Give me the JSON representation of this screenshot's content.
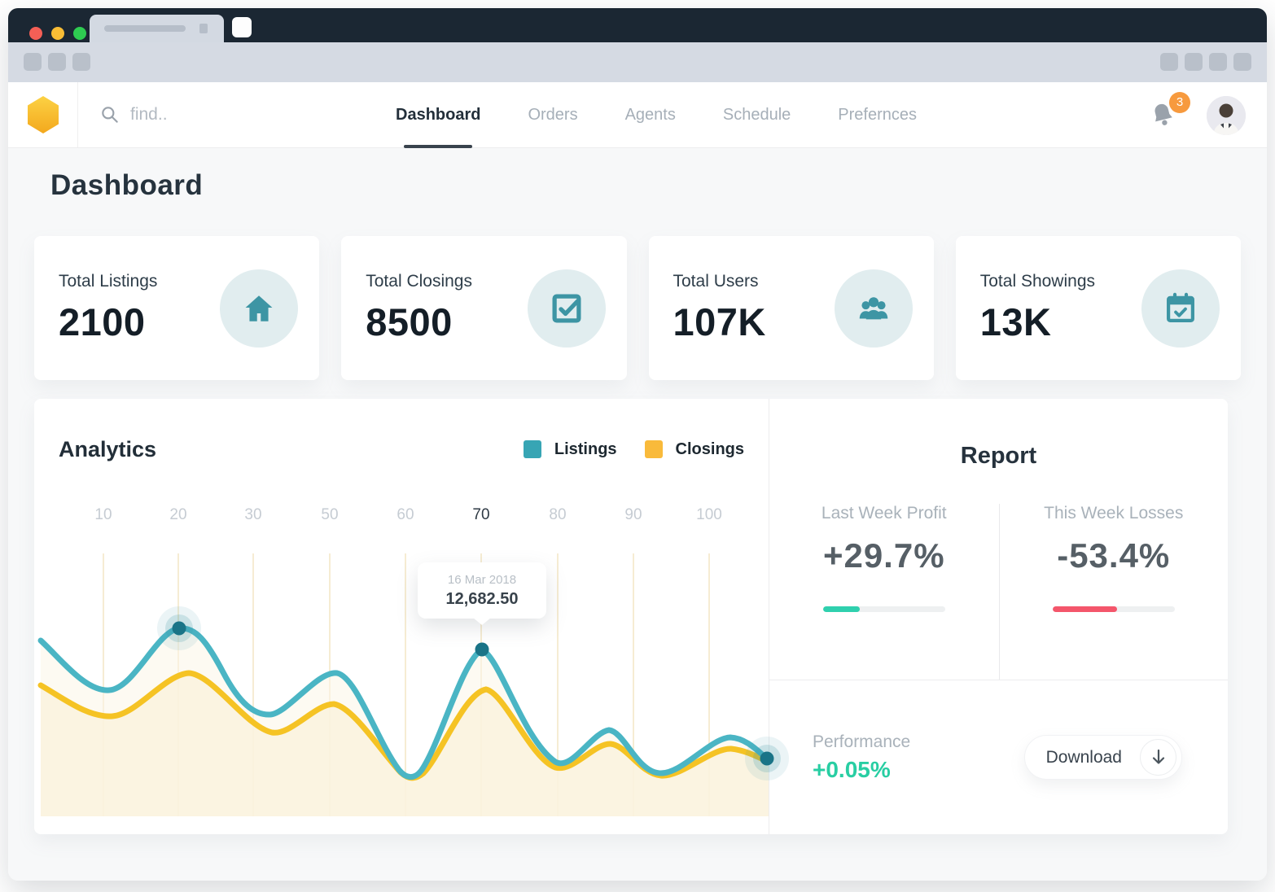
{
  "header": {
    "search": {
      "placeholder": "find.."
    },
    "nav": {
      "items": [
        {
          "label": "Dashboard",
          "active": true
        },
        {
          "label": "Orders",
          "active": false
        },
        {
          "label": "Agents",
          "active": false
        },
        {
          "label": "Schedule",
          "active": false
        },
        {
          "label": "Prefernces",
          "active": false
        }
      ]
    },
    "notifications": {
      "count": "3"
    }
  },
  "page": {
    "title": "Dashboard"
  },
  "stats": [
    {
      "label": "Total Listings",
      "value": "2100",
      "icon": "home-icon"
    },
    {
      "label": "Total Closings",
      "value": "8500",
      "icon": "check-square-icon"
    },
    {
      "label": "Total Users",
      "value": "107K",
      "icon": "users-icon"
    },
    {
      "label": "Total Showings",
      "value": "13K",
      "icon": "calendar-check-icon"
    }
  ],
  "analytics": {
    "title": "Analytics",
    "legend": [
      {
        "label": "Listings",
        "color": "#37a5b4"
      },
      {
        "label": "Closings",
        "color": "#f9ba3b"
      }
    ],
    "x_ticks": [
      "10",
      "20",
      "30",
      "50",
      "60",
      "70",
      "80",
      "90",
      "100"
    ],
    "active_tick": "70",
    "tooltip": {
      "date": "16 Mar 2018",
      "value": "12,682.50"
    }
  },
  "chart_data": {
    "type": "line",
    "x": [
      10,
      20,
      30,
      50,
      60,
      70,
      80,
      90,
      100
    ],
    "series": [
      {
        "name": "Listings",
        "color": "#37a5b4",
        "approx_values_pct": [
          45,
          67,
          38,
          50,
          14,
          59,
          19,
          17,
          27
        ]
      },
      {
        "name": "Closings",
        "color": "#f9ba3b",
        "approx_values_pct": [
          36,
          50,
          30,
          39,
          13,
          45,
          17,
          15,
          23
        ]
      }
    ],
    "highlighted_point": {
      "x": 70,
      "series": "Listings",
      "date": "16 Mar 2018",
      "value": "12,682.50"
    },
    "title": "Analytics",
    "xlabel": "",
    "ylabel": "",
    "grid": "vertical-only",
    "legend_position": "top-right"
  },
  "report": {
    "title": "Report",
    "metrics": [
      {
        "label": "Last Week Profit",
        "value": "+29.7%",
        "bar_color": "#2fd0ae",
        "bar_pct": 30
      },
      {
        "label": "This Week Losses",
        "value": "-53.4%",
        "bar_color": "#f4566b",
        "bar_pct": 53
      }
    ],
    "performance": {
      "label": "Performance",
      "value": "+0.05%",
      "color": "#28cea3"
    },
    "download_label": "Download"
  }
}
